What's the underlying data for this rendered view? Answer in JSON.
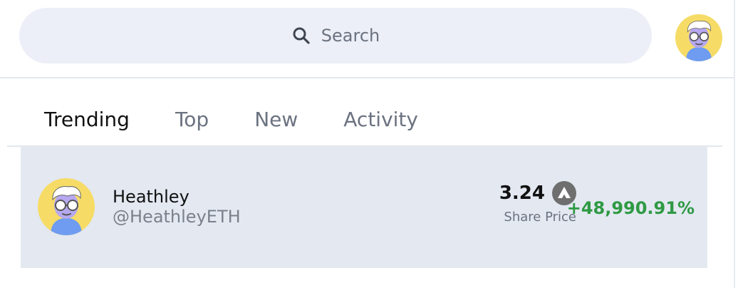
{
  "colors": {
    "search_bg": "#eceff7",
    "row_bg": "#e3e8f1",
    "positive": "#2f9a44",
    "muted_text": "#6b7280",
    "avatar_bg": "#f6dc67"
  },
  "header": {
    "search": {
      "icon": "search-icon",
      "placeholder": "Search"
    },
    "profile_avatar": {
      "icon": "user-avatar"
    }
  },
  "tabs": [
    {
      "label": "Trending",
      "active": true
    },
    {
      "label": "Top",
      "active": false
    },
    {
      "label": "New",
      "active": false
    },
    {
      "label": "Activity",
      "active": false
    }
  ],
  "list": [
    {
      "name": "Heathley",
      "handle": "@HeathleyETH",
      "price": "3.24",
      "currency_icon": "avax-icon",
      "price_caption": "Share Price",
      "change": "+48,990.91%"
    }
  ]
}
